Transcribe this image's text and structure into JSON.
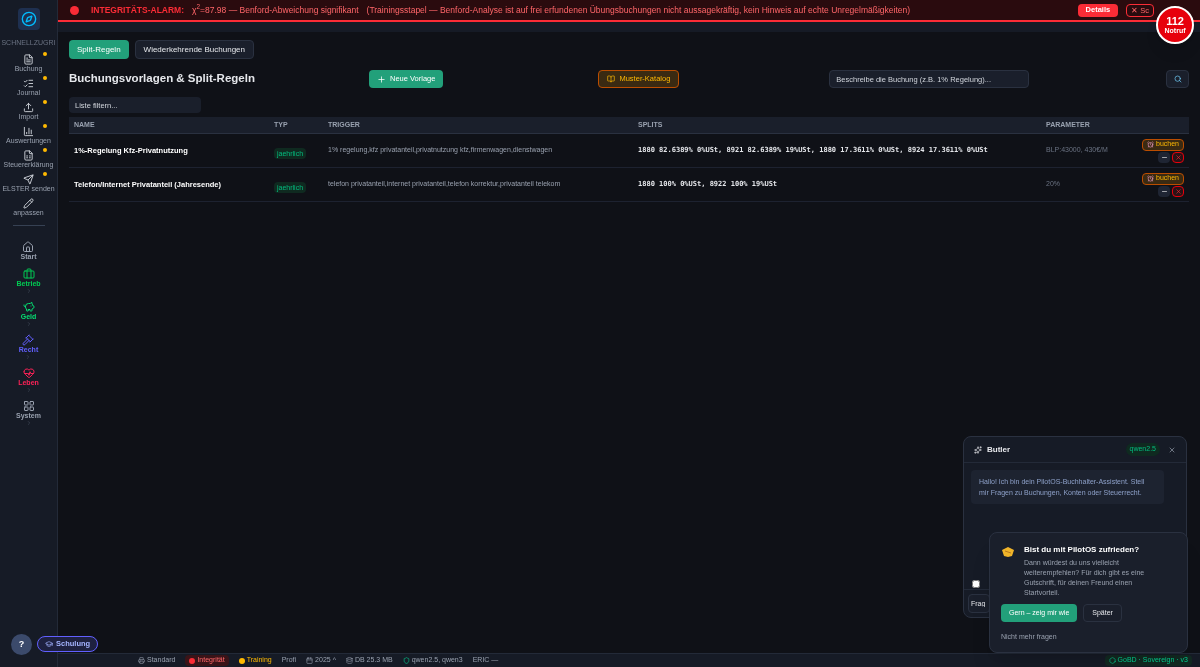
{
  "sidebar": {
    "section_label": "SCHNELLZUGRI",
    "quick": [
      {
        "label": "Buchung",
        "starred": true
      },
      {
        "label": "Journal",
        "starred": true
      },
      {
        "label": "Import",
        "starred": true
      },
      {
        "label": "Auswertungen",
        "starred": true
      },
      {
        "label": "Steuererklärung",
        "starred": true
      },
      {
        "label": "ELSTER senden",
        "starred": true
      },
      {
        "label": "anpassen",
        "starred": false
      }
    ],
    "areas": [
      {
        "label": "Start",
        "expandable": false
      },
      {
        "label": "Betrieb",
        "expandable": true
      },
      {
        "label": "Geld",
        "expandable": true
      },
      {
        "label": "Recht",
        "expandable": true
      },
      {
        "label": "Leben",
        "expandable": true
      },
      {
        "label": "System",
        "expandable": true
      }
    ]
  },
  "alarm": {
    "title": "INTEGRITÄTS-ALARM:",
    "message": "χ$^{2}$=87.98 — Benford-Abweichung signifikant",
    "note": "(Trainingsstapel — Benford-Analyse ist auf frei erfundenen Übungsbuchungen nicht aussagekräftig, kein Hinweis auf echte Unregelmäßigkeiten)",
    "details": "Details",
    "close": "✕ Sc"
  },
  "emergency": {
    "number": "112",
    "label": "Notruf"
  },
  "tabs": [
    {
      "label": "Split-Regeln",
      "selected": true
    },
    {
      "label": "Wiederkehrende Buchungen",
      "selected": false
    }
  ],
  "title": "Buchungsvorlagen & Split-Regeln",
  "new_button": "Neue Vorlage",
  "catalog_button": "Muster-Katalog",
  "describe": {
    "placeholder": "Beschreibe die Buchung (z.B. 1% Regelung)..."
  },
  "filter": {
    "placeholder": "Liste filtern..."
  },
  "table": {
    "columns": [
      "NAME",
      "TYP",
      "TRIGGER",
      "SPLITS",
      "PARAMETER"
    ],
    "rows": [
      {
        "name": "1%-Regelung Kfz-Privatnutzung",
        "type": "jaehrlich",
        "trigger": "1% regelung,kfz privatanteil,privatnutzung kfz,firmenwagen,dienstwagen",
        "splits": "1880 82.6389% 0%USt, 8921 82.6389% 19%USt, 1880 17.3611% 0%USt, 8924 17.3611% 0%USt",
        "parameter": "BLP:43000, 430€/M",
        "book": "buchen"
      },
      {
        "name": "Telefon/Internet Privatanteil (Jahresende)",
        "type": "jaehrlich",
        "trigger": "telefon privatanteil,internet privatanteil,telefon korrektur,privatanteil telekom",
        "splits": "1880 100% 0%USt, 8922 100% 19%USt",
        "parameter": "20%",
        "book": "buchen"
      }
    ]
  },
  "butler": {
    "title": "Butler",
    "model": "qwen2.5",
    "greeting": "Hallo! Ich bin dein PilotOS-Buchhalter-Assistent. Stell mir Fragen zu Buchungen, Konten oder Steuerrecht.",
    "input_value": "Frag",
    "checked": false
  },
  "feedback": {
    "title": "Bist du mit PilotOS zufrieden?",
    "text": "Dann würdest du uns vielleicht weiterempfehlen? Für dich gibt es eine Gutschrift, für deinen Freund einen Startvorteil.",
    "primary": "Gern – zeig mir wie",
    "secondary": "Später",
    "dismiss": "Nicht mehr fragen"
  },
  "help": "?",
  "training_button": "Schulung",
  "status_bar": {
    "items": [
      "Standard",
      "Integrität",
      "Training",
      "Profi",
      "2025 ^",
      "DB 25.3 MB",
      "qwen2.5, qwen3",
      "ERIC —"
    ],
    "right": "GoBD · Sovereign · v3"
  }
}
